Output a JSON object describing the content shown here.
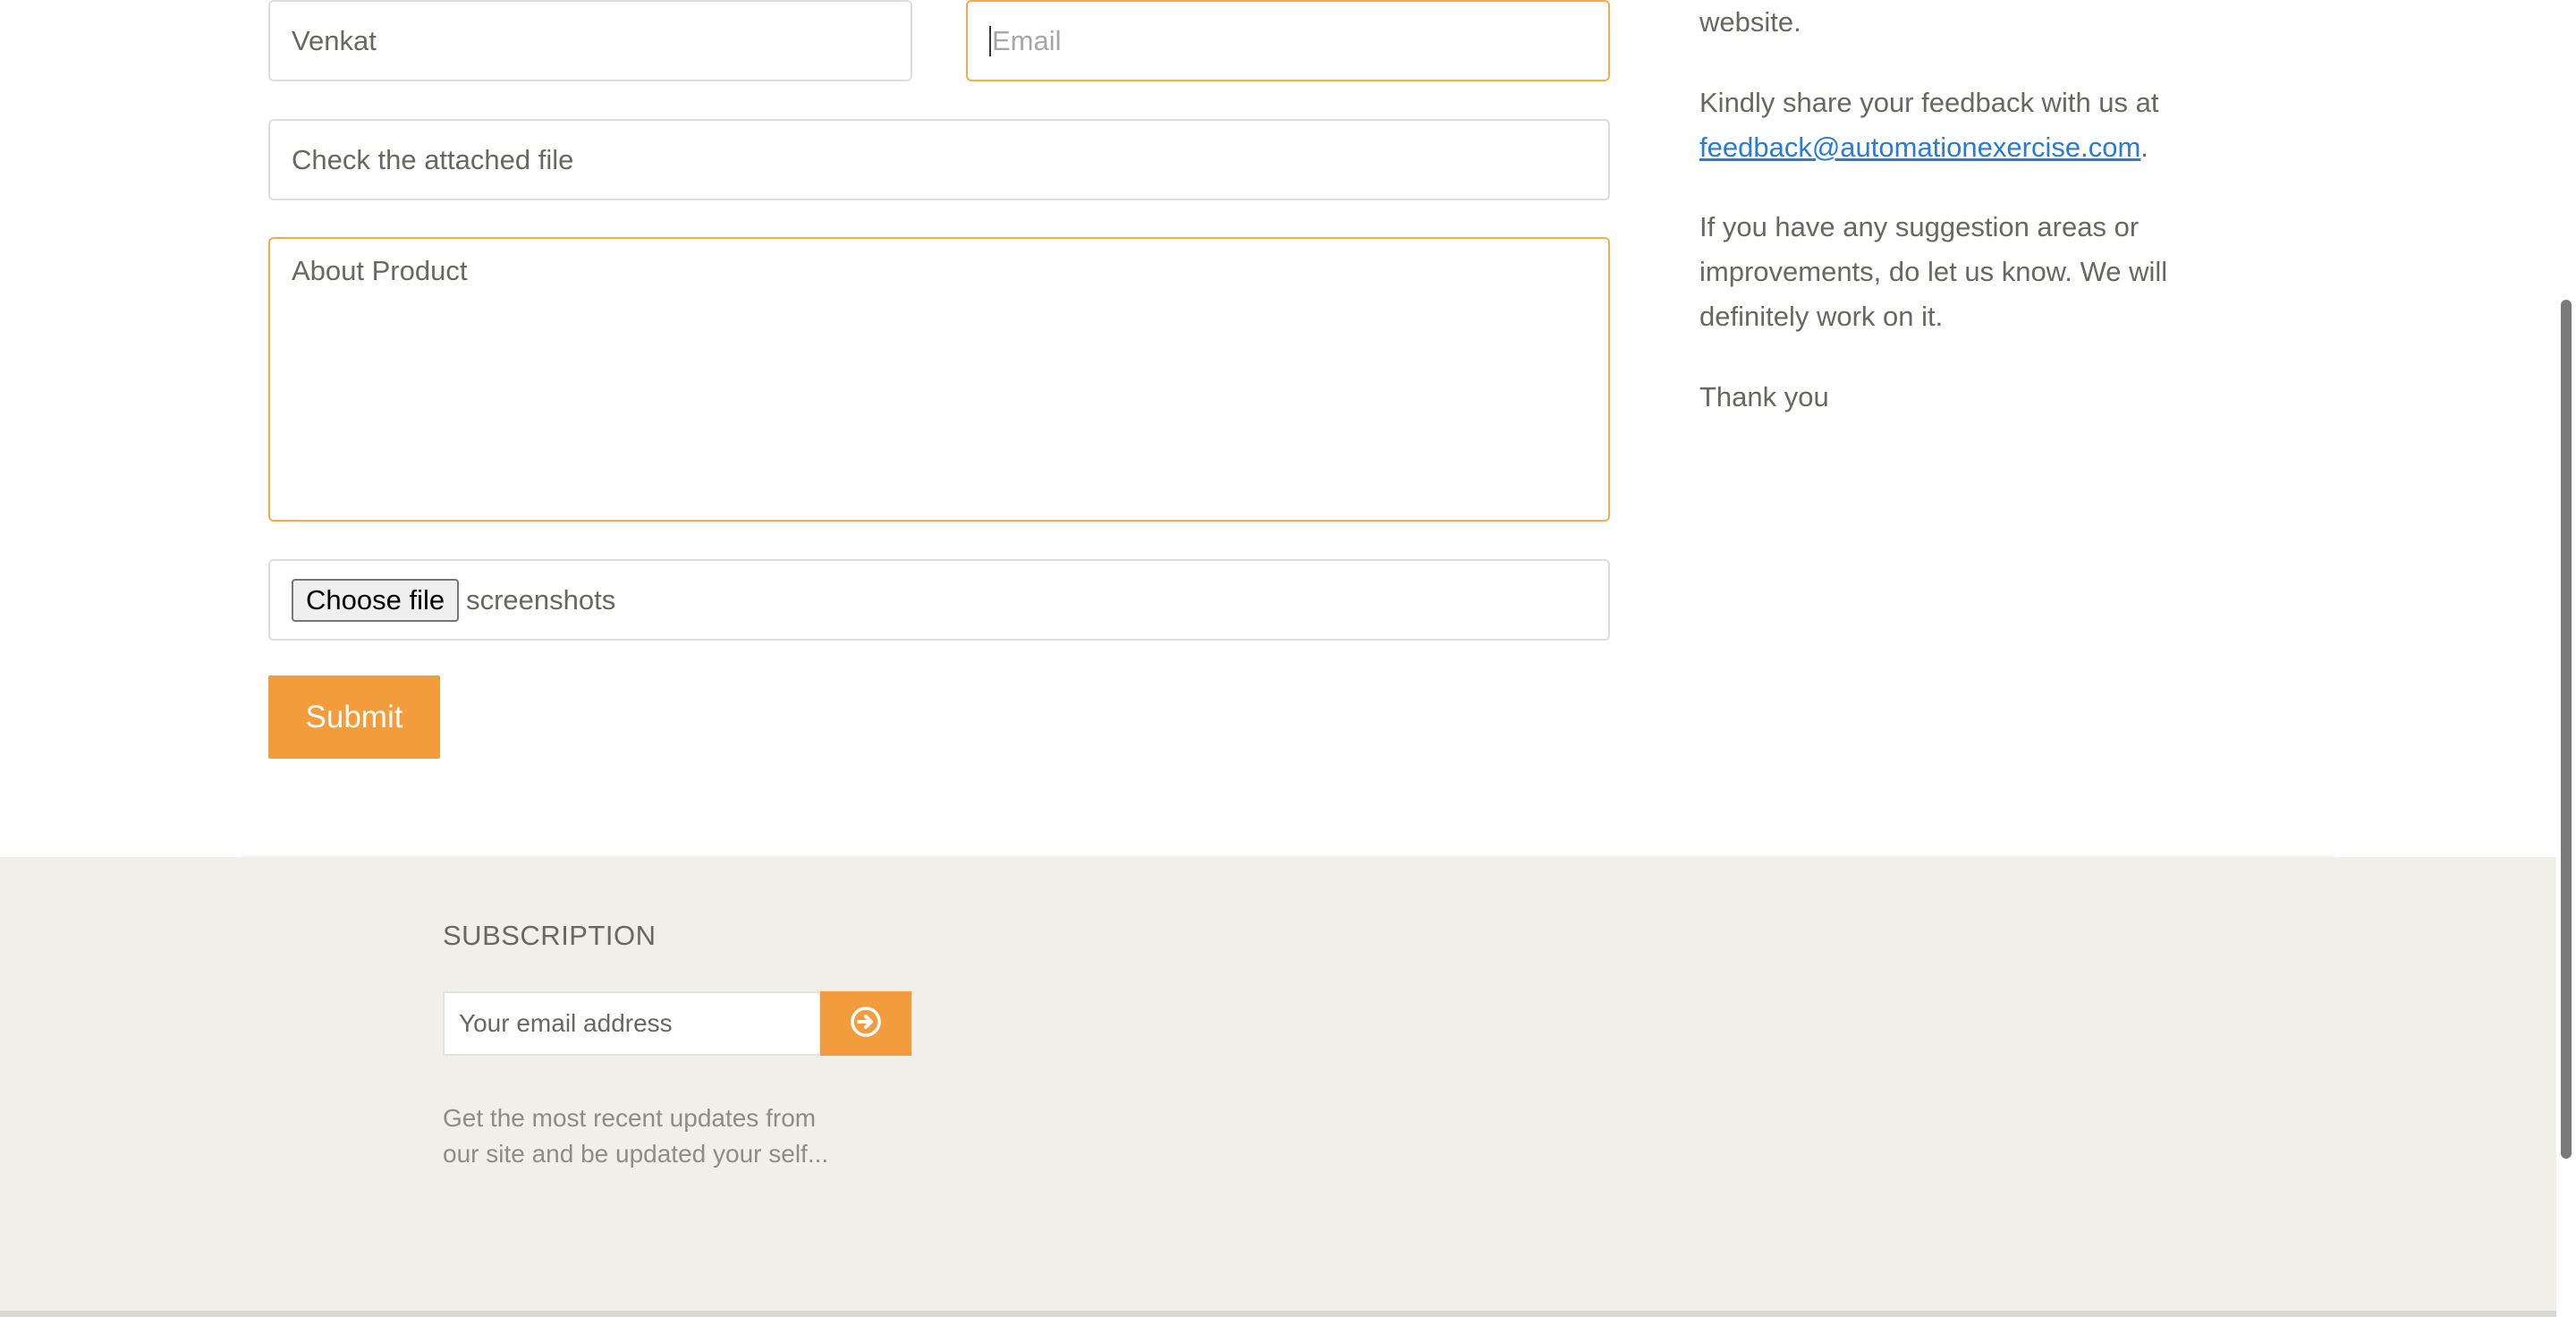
{
  "form": {
    "name_value": "Venkat",
    "email_placeholder": "Email",
    "subject_value": "Check the attached file",
    "message_value": "About Product",
    "file_button_label": "Choose file",
    "file_name": "screenshots",
    "submit_label": "Submit"
  },
  "side": {
    "para1_tail": "website.",
    "para2_prefix": "Kindly share your feedback with us at",
    "feedback_email": "feedback@automationexercise.com",
    "para2_suffix": ".",
    "para3_line1": "If you have any suggestion areas or",
    "para3_line2": "improvements, do let us know. We will",
    "para3_line3": "definitely work on it.",
    "para4": "Thank you"
  },
  "footer": {
    "subscription_title": "SUBSCRIPTION",
    "email_placeholder": "Your email address",
    "desc_line1": "Get the most recent updates from",
    "desc_line2": "our site and be updated your self..."
  },
  "colors": {
    "accent": "#f39c3b",
    "link": "#2b7bd3",
    "footer_bg": "#f0f0e9",
    "focus_border": "#f0ad4e"
  },
  "icons": {
    "subscribe": "arrow-circle-right-icon"
  }
}
